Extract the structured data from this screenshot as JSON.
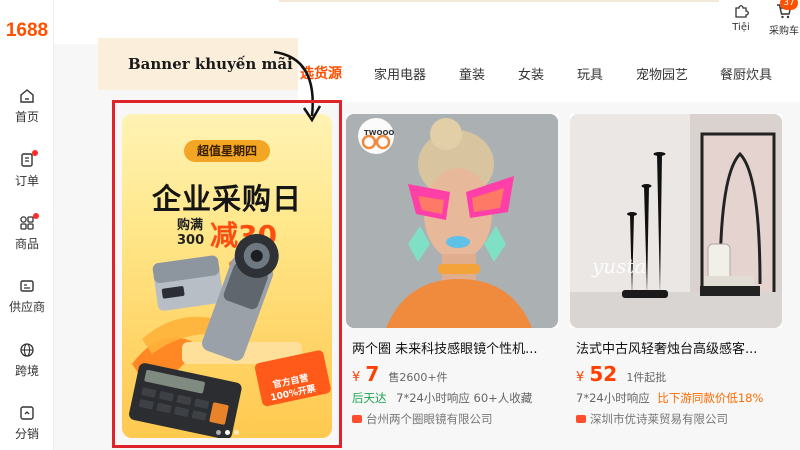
{
  "brand": {
    "logo": "1688"
  },
  "sidebar": {
    "items": [
      {
        "label": "首页"
      },
      {
        "label": "订单"
      },
      {
        "label": "商品"
      },
      {
        "label": "供应商"
      },
      {
        "label": "跨境"
      },
      {
        "label": "分销"
      }
    ]
  },
  "topbar": {
    "tools_label": "Tiệi",
    "cart_label": "采购车",
    "cart_count": "37"
  },
  "tabs": [
    {
      "label": "选货源",
      "active": true
    },
    {
      "label": "家用电器"
    },
    {
      "label": "童装"
    },
    {
      "label": "女装"
    },
    {
      "label": "玩具"
    },
    {
      "label": "宠物园艺"
    },
    {
      "label": "餐厨炊具"
    }
  ],
  "annotation": {
    "label": "Banner khuyến mãi",
    "color": "#e0232b"
  },
  "banner": {
    "pill": "超值星期四",
    "title": "企业采购日",
    "buy_line1": "购满",
    "buy_line2": "300",
    "discount": "减30",
    "stamp_line1": "官方自营",
    "stamp_line2": "100%开票"
  },
  "products": [
    {
      "image_brand": "TWOOO",
      "title": "两个圈 未来科技感眼镜个性机...",
      "currency": "¥",
      "price": "7",
      "sub": "售2600+件",
      "meta_highlight": "后天达",
      "meta_rest": "7*24小时响应  60+人收藏",
      "shop": "台州两个圈眼镜有限公司"
    },
    {
      "image_brand": "yusta",
      "title": "法式中古风轻奢烛台高级感客...",
      "currency": "¥",
      "price": "52",
      "sub": "1件起批",
      "meta_prefix": "7*24小时响应",
      "meta_highlight": "比下游同款价低18%",
      "shop": "深圳市优诗莱贸易有限公司"
    }
  ],
  "colors": {
    "brand": "#ff5000",
    "price": "#ff4000",
    "green": "#1aa34a"
  }
}
